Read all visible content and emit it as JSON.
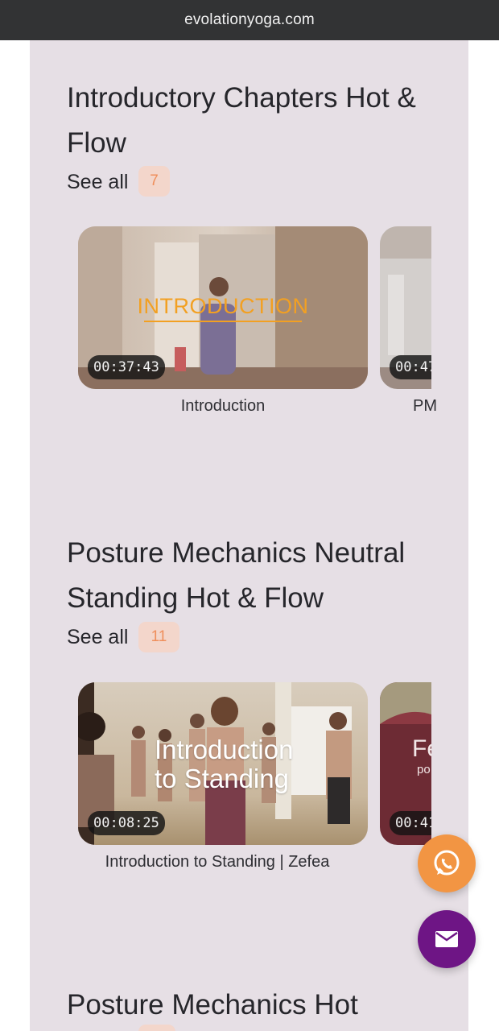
{
  "browser": {
    "url": "evolationyoga.com"
  },
  "sections": [
    {
      "title": "Introductory Chapters Hot & Flow",
      "see_all": "See all",
      "count": "7",
      "videos": [
        {
          "caption": "Introduction",
          "duration": "00:37:43",
          "overlay_text": "INTRODUCTION"
        },
        {
          "caption": "PM",
          "duration": "00:47"
        }
      ]
    },
    {
      "title": "Posture Mechanics Neutral Standing Hot & Flow",
      "see_all": "See all",
      "count": "11",
      "videos": [
        {
          "caption": "Introduction to Standing | Zefea",
          "duration": "00:08:25",
          "overlay_line1": "Introduction",
          "overlay_line2": "to Standing"
        },
        {
          "duration": "00:41",
          "overlay_text": "Fe",
          "overlay_sub": "po"
        }
      ]
    },
    {
      "title": "Posture Mechanics Hot"
    }
  ],
  "fabs": {
    "whatsapp_icon": "whatsapp-icon",
    "mail_icon": "mail-icon",
    "whatsapp_color": "#f29543",
    "mail_color": "#6e1585"
  }
}
